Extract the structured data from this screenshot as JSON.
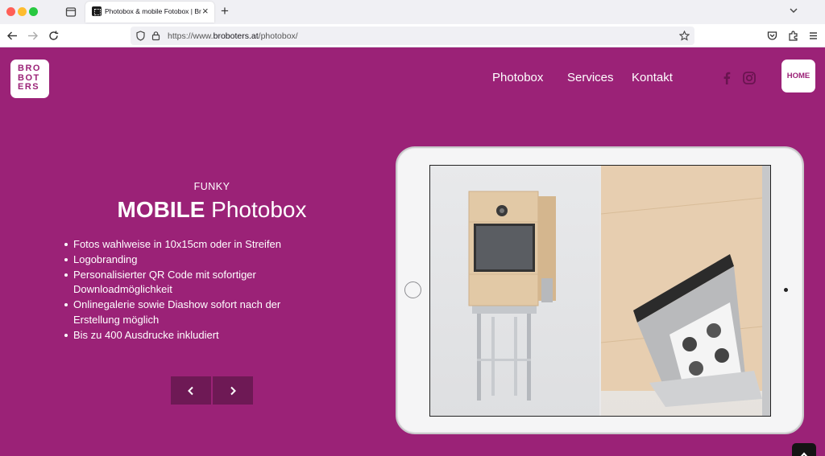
{
  "browser": {
    "tab_title": "Photobox & mobile Fotobox | Broboters",
    "url_scheme": "https://www.",
    "url_domain": "broboters.at",
    "url_path": "/photobox/"
  },
  "header": {
    "logo_lines": [
      "BRO",
      "BOT",
      "ERS"
    ],
    "menu": [
      {
        "label": "Photobox"
      },
      {
        "label": "Services"
      },
      {
        "label": "Kontakt"
      }
    ],
    "social": [
      "facebook-icon",
      "instagram-icon"
    ],
    "home_label": "HOME"
  },
  "hero": {
    "subtitle": "FUNKY",
    "headline_bold": "MOBILE",
    "headline_light": "Photobox",
    "features": [
      "Fotos wahlweise in 10x15cm oder in Streifen",
      "Logobranding",
      "Personalisierter QR Code mit sofortiger Downloadmöglichkeit",
      "Onlinegalerie sowie Diashow sofort nach der Erstellung möglich",
      "Bis zu 400 Ausdrucke inkludiert"
    ],
    "prev_icon": "chevron-left-icon",
    "next_icon": "chevron-right-icon"
  },
  "colors": {
    "brand": "#9b2277",
    "button_dark": "#6e1955"
  }
}
